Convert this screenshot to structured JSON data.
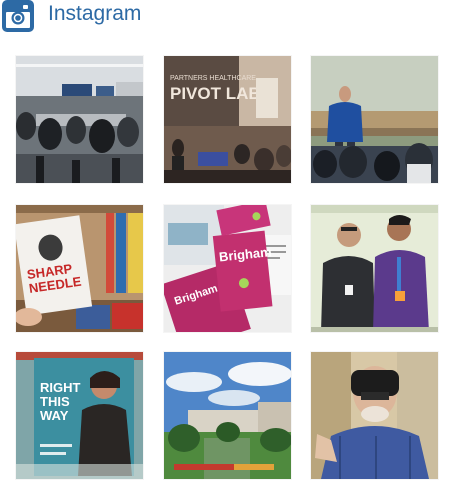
{
  "widget": {
    "title": "Instagram",
    "brand_color": "#2d6aa5",
    "icon": "instagram-icon"
  },
  "photos": {
    "p1": {
      "subject": "meeting-room-audience"
    },
    "p2": {
      "subject": "pivot-labs-event",
      "sign_line1": "PARTNERS HEALTHCARE",
      "sign_line2": "PIVOT LABS"
    },
    "p3": {
      "subject": "speaker-on-stage"
    },
    "p4": {
      "subject": "sharp-needle-book",
      "book_word1": "SHARP",
      "book_word2": "NEEDLE"
    },
    "p5": {
      "subject": "brigham-magazines",
      "magazine_title": "Brigham"
    },
    "p6": {
      "subject": "two-colleagues-portrait"
    },
    "p7": {
      "subject": "magazine-cover-right-this-way",
      "cover_line1": "RIGHT",
      "cover_line2": "THIS",
      "cover_line3": "WAY"
    },
    "p8": {
      "subject": "hospital-campus-exterior"
    },
    "p9": {
      "subject": "person-vr-headset"
    }
  }
}
